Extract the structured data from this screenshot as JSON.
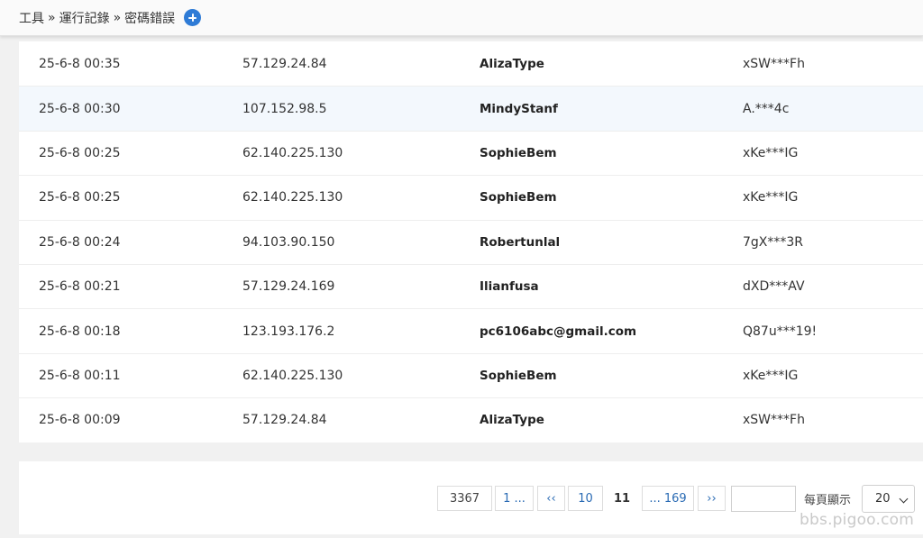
{
  "breadcrumb": {
    "items": [
      "工具",
      "運行記錄",
      "密碼錯誤"
    ],
    "separator": "»"
  },
  "add_icon": "plus-circle-icon",
  "accent_color": "#2e7bd6",
  "rows": [
    {
      "time": "25-6-8 00:35",
      "ip": "57.129.24.84",
      "user": "AlizaType",
      "pass": "xSW***Fh"
    },
    {
      "time": "25-6-8 00:30",
      "ip": "107.152.98.5",
      "user": "MindyStanf",
      "pass": "A.***4c"
    },
    {
      "time": "25-6-8 00:25",
      "ip": "62.140.225.130",
      "user": "SophieBem",
      "pass": "xKe***IG"
    },
    {
      "time": "25-6-8 00:25",
      "ip": "62.140.225.130",
      "user": "SophieBem",
      "pass": "xKe***IG"
    },
    {
      "time": "25-6-8 00:24",
      "ip": "94.103.90.150",
      "user": "Robertunlal",
      "pass": "7gX***3R"
    },
    {
      "time": "25-6-8 00:21",
      "ip": "57.129.24.169",
      "user": "Ilianfusa",
      "pass": "dXD***AV"
    },
    {
      "time": "25-6-8 00:18",
      "ip": "123.193.176.2",
      "user": "pc6106abc@gmail.com",
      "pass": "Q87u***19!"
    },
    {
      "time": "25-6-8 00:11",
      "ip": "62.140.225.130",
      "user": "SophieBem",
      "pass": "xKe***IG"
    },
    {
      "time": "25-6-8 00:09",
      "ip": "57.129.24.84",
      "user": "AlizaType",
      "pass": "xSW***Fh"
    }
  ],
  "pagination": {
    "total": "3367",
    "first": "1 ...",
    "prev": "‹‹",
    "prev_page": "10",
    "current": "11",
    "last": "... 169",
    "next": "››",
    "goto_value": "",
    "per_page_label": "每頁顯示",
    "per_page_value": "20"
  },
  "watermark": "bbs.pigoo.com"
}
